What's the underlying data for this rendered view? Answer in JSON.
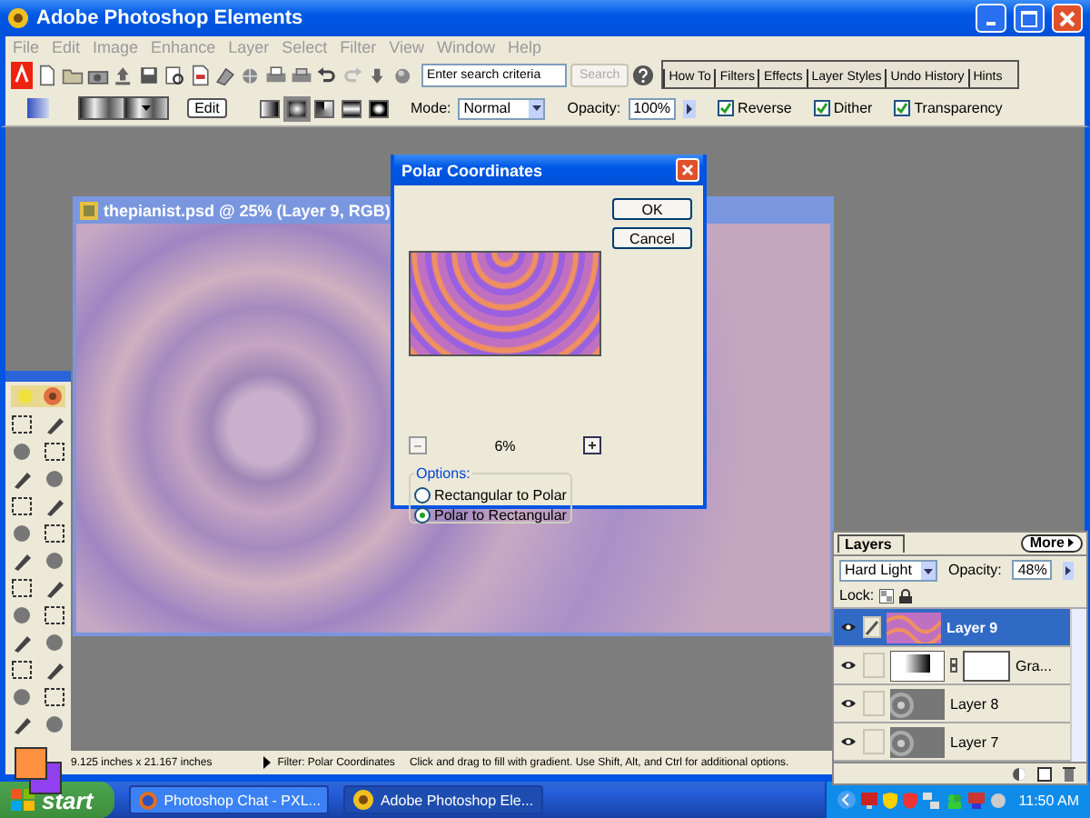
{
  "app_window": {
    "title": "Adobe Photoshop Elements"
  },
  "menu": [
    "File",
    "Edit",
    "Image",
    "Enhance",
    "Layer",
    "Select",
    "Filter",
    "View",
    "Window",
    "Help"
  ],
  "toolbar": {
    "search": {
      "placeholder": "Enter search criteria"
    },
    "search_button": {
      "label": "Search",
      "disabled": true
    },
    "palette_tabs": [
      "How To",
      "Filters",
      "Effects",
      "Layer Styles",
      "Undo History",
      "Hints"
    ]
  },
  "options_bar": {
    "edit_button": "Edit",
    "gradient_types": [
      {
        "selected": false
      },
      {
        "selected": true
      },
      {
        "selected": false
      },
      {
        "selected": false
      },
      {
        "selected": false
      }
    ],
    "mode_label": "Mode:",
    "mode": "Normal",
    "opacity_label": "Opacity:",
    "opacity": "100%",
    "checkboxes": [
      {
        "label": "Reverse",
        "checked": true
      },
      {
        "label": "Dither",
        "checked": true
      },
      {
        "label": "Transparency",
        "checked": true
      }
    ]
  },
  "document": {
    "title": "thepianist.psd @ 25% (Layer 9, RGB)"
  },
  "dialog": {
    "title": "Polar Coordinates",
    "buttons": [
      "OK",
      "Cancel"
    ],
    "zoom": "6%",
    "options_label": "Options:",
    "options": [
      {
        "label": "Rectangular to Polar",
        "selected": false
      },
      {
        "label": "Polar to Rectangular",
        "selected": true
      }
    ]
  },
  "layers": {
    "tab": "Layers",
    "more": "More",
    "blend_mode": "Hard Light",
    "opacity_label": "Opacity:",
    "opacity": "48%",
    "lock_label": "Lock:",
    "rows": [
      {
        "name": "Layer 9",
        "kind": "pattern",
        "selected": true
      },
      {
        "name": "Gra...",
        "kind": "fill",
        "selected": false
      },
      {
        "name": "Layer 8",
        "kind": "image",
        "selected": false
      },
      {
        "name": "Layer 7",
        "kind": "image",
        "selected": false
      }
    ]
  },
  "status_bar": {
    "doc_size": "9.125 inches x 21.167 inches",
    "filter": "Filter: Polar Coordinates",
    "hint": "Click and drag to fill with gradient.  Use Shift, Alt, and Ctrl for additional options."
  },
  "taskbar": {
    "start": "start",
    "tasks": [
      {
        "label": "Photoshop Chat - PXL...",
        "selected": false
      },
      {
        "label": "Adobe Photoshop Ele...",
        "selected": true
      }
    ],
    "clock": "11:50 AM"
  }
}
